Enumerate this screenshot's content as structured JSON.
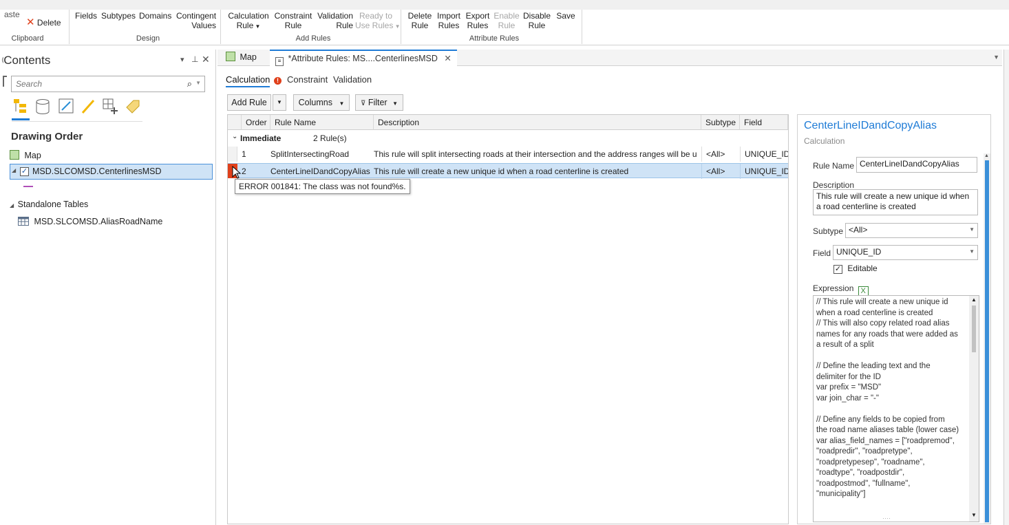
{
  "ribbon": {
    "clipboard": {
      "paste_label": "aste",
      "delete_label": "Delete",
      "group_label": "Clipboard"
    },
    "design": {
      "fields_label": "Fields",
      "subtypes_label": "Subtypes",
      "domains_label": "Domains",
      "contingent_label_1": "Contingent",
      "contingent_label_2": "Values",
      "group_label": "Design"
    },
    "add_rules": {
      "calc_1": "Calculation",
      "calc_2": "Rule",
      "constraint_1": "Constraint",
      "constraint_2": "Rule",
      "validation_1": "Validation",
      "validation_2": "Rule",
      "ready_1": "Ready to",
      "ready_2": "Use Rules",
      "group_label": "Add Rules"
    },
    "attribute_rules": {
      "delete_1": "Delete",
      "delete_2": "Rule",
      "import_1": "Import",
      "import_2": "Rules",
      "export_1": "Export",
      "export_2": "Rules",
      "enable_1": "Enable",
      "enable_2": "Rule",
      "disable_1": "Disable",
      "disable_2": "Rule",
      "save_label": "Save",
      "group_label": "Attribute Rules"
    }
  },
  "contents": {
    "title": "Contents",
    "search_placeholder": "Search",
    "drawing_order": "Drawing Order",
    "map_label": "Map",
    "layer_label": "MSD.SLCOMSD.CenterlinesMSD",
    "standalone_label": "Standalone Tables",
    "table_label": "MSD.SLCOMSD.AliasRoadName"
  },
  "doc_tabs": {
    "map_tab": "Map",
    "rules_tab": "*Attribute Rules: MS....CenterlinesMSD"
  },
  "rule_tabs": {
    "calculation": "Calculation",
    "constraint": "Constraint",
    "validation": "Validation"
  },
  "toolbar": {
    "add_rule": "Add Rule",
    "columns": "Columns",
    "filter": "Filter"
  },
  "grid": {
    "headers": {
      "order": "Order",
      "rule_name": "Rule Name",
      "description": "Description",
      "subtype": "Subtype",
      "field": "Field"
    },
    "group": {
      "label": "Immediate",
      "count": "2 Rule(s)"
    },
    "rows": [
      {
        "order": "1",
        "name": "SplitIntersectingRoad",
        "description": "This rule will split intersecting roads at their intersection and the address ranges will be u",
        "subtype": "<All>",
        "field": "UNIQUE_ID"
      },
      {
        "order": "2",
        "name": "CenterLineIDandCopyAlias",
        "description": "This rule will create a new unique id when a road centerline is created",
        "subtype": "<All>",
        "field": "UNIQUE_ID"
      }
    ],
    "tooltip": "ERROR 001841: The class was not found%s."
  },
  "rule_panel": {
    "title": "CenterLineIDandCopyAlias",
    "subtitle": "Calculation",
    "rule_name_label": "Rule Name",
    "rule_name_value": "CenterLineIDandCopyAlias",
    "description_label": "Description",
    "description_value": "This rule will create a new unique id when a road centerline is created",
    "subtype_label": "Subtype",
    "subtype_value": "<All>",
    "field_label": "Field",
    "field_value": "UNIQUE_ID",
    "editable_label": "Editable",
    "expression_label": "Expression",
    "expression_lines": [
      "// This rule will create a new unique id",
      "when a road centerline is created",
      "// This will also copy related road alias",
      "names for any roads that were added as",
      "a result of a split",
      "",
      "// Define the leading text and the",
      "delimiter for the ID",
      "var prefix = \"MSD\"",
      "var join_char = \"-\"",
      "",
      "// Define any fields to be copied from",
      "the road name aliases table (lower case)",
      "var alias_field_names = [\"roadpremod\",",
      "\"roadpredir\", \"roadpretype\",",
      "\"roadpretypesep\", \"roadname\",",
      "\"roadtype\", \"roadpostdir\",",
      "\"roadpostmod\", \"fullname\",",
      "\"municipality\"]"
    ]
  },
  "colors": {
    "accent": "#1e7bd6",
    "selected_row": "#cfe3f6",
    "error": "#e0401b"
  }
}
